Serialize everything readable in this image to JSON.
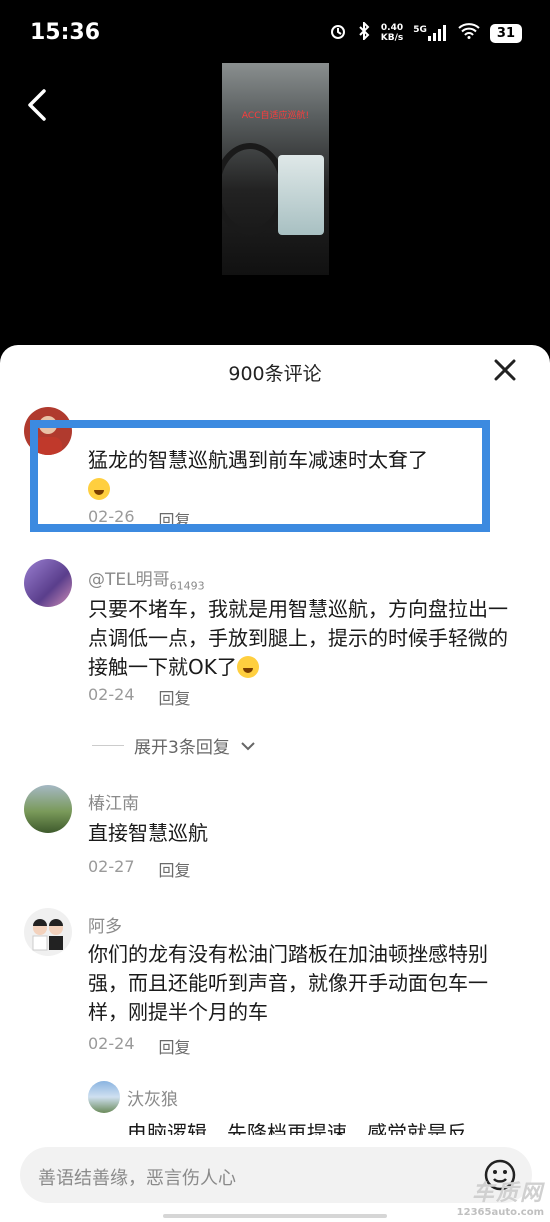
{
  "status": {
    "time": "15:36",
    "net_speed_value": "0.40",
    "net_speed_unit": "KB/s",
    "signal_label": "5G",
    "battery": "31"
  },
  "video": {
    "caption": "ACC自适应巡航!"
  },
  "sheet": {
    "title": "900条评论"
  },
  "comments": [
    {
      "name": "",
      "text": "猛龙的智慧巡航遇到前车减速时太耷了",
      "has_emoji": true,
      "date": "02-26",
      "reply": "回复",
      "avatar_color": "#b03a2e"
    },
    {
      "name": "@TEL明哥",
      "name_suffix": "61493",
      "text": "只要不堵车，我就是用智慧巡航，方向盘拉出一点调低一点，手放到腿上，提示的时候手轻微的接触一下就OK了",
      "has_emoji": true,
      "date": "02-24",
      "reply": "回复",
      "avatar_color": "#7a5ca8"
    },
    {
      "name": "椿江南",
      "text": "直接智慧巡航",
      "date": "02-27",
      "reply": "回复",
      "avatar_color": "#5c7a4a"
    },
    {
      "name": "阿多",
      "text": "你们的龙有没有松油门踏板在加油顿挫感特别强，而且还能听到声音，就像开手动面包车一样，刚提半个月的车",
      "date": "02-24",
      "reply": "回复",
      "avatar_color": "#e8e8e8"
    }
  ],
  "expand_replies": "展开3条回复",
  "subcomment": {
    "name": "汏灰狼",
    "text": "电脑逻辑，先降档再提速，感觉就是反"
  },
  "input": {
    "placeholder": "善语结善缘，恶言伤人心"
  },
  "watermark": {
    "main": "车质网",
    "sub": "12365auto.com"
  },
  "colors": {
    "highlight": "#3c8ae0",
    "meta_gray": "#9a9a9a"
  }
}
